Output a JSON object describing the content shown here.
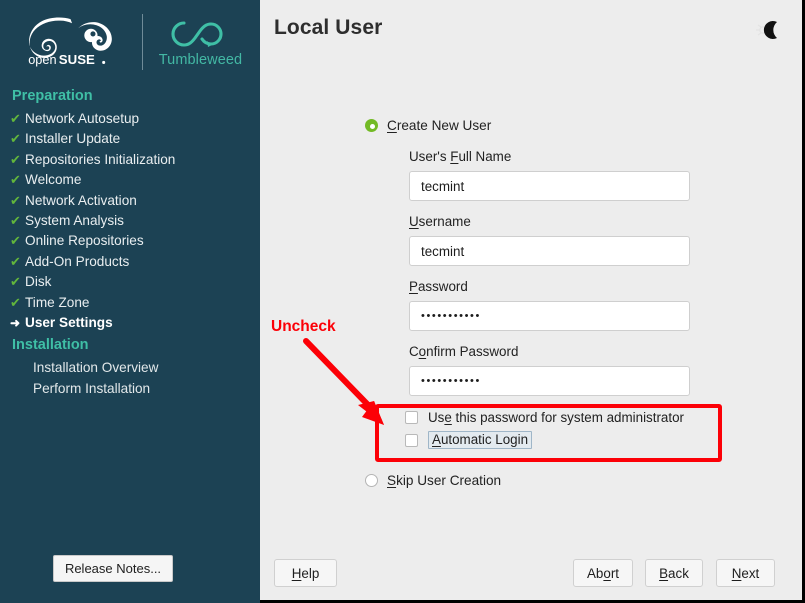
{
  "sidebar": {
    "logo_alt": "openSUSE",
    "product_label": "Tumbleweed",
    "sections": [
      {
        "heading": "Preparation",
        "steps": [
          {
            "label": "Network Autosetup",
            "state": "done"
          },
          {
            "label": "Installer Update",
            "state": "done"
          },
          {
            "label": "Repositories Initialization",
            "state": "done"
          },
          {
            "label": "Welcome",
            "state": "done"
          },
          {
            "label": "Network Activation",
            "state": "done"
          },
          {
            "label": "System Analysis",
            "state": "done"
          },
          {
            "label": "Online Repositories",
            "state": "done"
          },
          {
            "label": "Add-On Products",
            "state": "done"
          },
          {
            "label": "Disk",
            "state": "done"
          },
          {
            "label": "Time Zone",
            "state": "done"
          },
          {
            "label": "User Settings",
            "state": "current"
          }
        ]
      },
      {
        "heading": "Installation",
        "steps": [
          {
            "label": "Installation Overview",
            "state": "pending"
          },
          {
            "label": "Perform Installation",
            "state": "pending"
          }
        ]
      }
    ],
    "release_notes_button": "Release Notes..."
  },
  "main": {
    "title": "Local User",
    "dark_mode_toggle": "moon-icon",
    "mode_options": [
      {
        "label": "Create New User",
        "mnemonic": "C",
        "selected": true
      },
      {
        "label": "Skip User Creation",
        "mnemonic": "S",
        "selected": false
      }
    ],
    "form": {
      "fields": [
        {
          "label": "User's Full Name",
          "mnemonic": "F",
          "value": "tecmint",
          "type": "text"
        },
        {
          "label": "Username",
          "mnemonic": "U",
          "value": "tecmint",
          "type": "text"
        },
        {
          "label": "Password",
          "mnemonic": "P",
          "value": "•••••••••••",
          "type": "password"
        },
        {
          "label": "Confirm Password",
          "mnemonic": "o",
          "value": "•••••••••••",
          "type": "password"
        }
      ],
      "checkboxes": [
        {
          "label": "Use this password for system administrator",
          "mnemonic": "e",
          "checked": false,
          "focused": false
        },
        {
          "label": "Automatic Login",
          "mnemonic": "A",
          "checked": false,
          "focused": true
        }
      ]
    },
    "annotation": {
      "text": "Uncheck",
      "color": "#fc0007"
    },
    "buttons": {
      "help": "Help",
      "abort": "Abort",
      "back": "Back",
      "next": "Next"
    }
  },
  "colors": {
    "sidebar_bg": "#1c4254",
    "accent_green": "#73ba25",
    "section_teal": "#3fbfa6",
    "check_green": "#62b63c",
    "annotation_red": "#fc0007",
    "main_bg": "#ededed"
  }
}
